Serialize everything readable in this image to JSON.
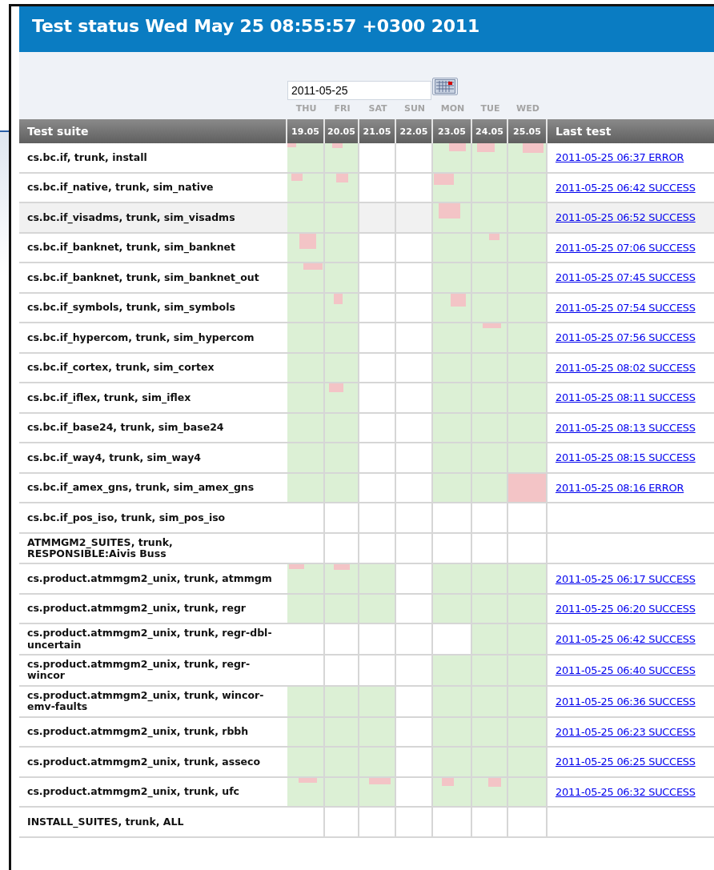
{
  "header": {
    "title": "Test status Wed May 25 08:55:57 +0300 2011"
  },
  "date_field": {
    "value": "2011-05-25"
  },
  "weekdays": [
    "THU",
    "FRI",
    "SAT",
    "SUN",
    "MON",
    "TUE",
    "WED"
  ],
  "table": {
    "columns": [
      "Test suite",
      "19.05",
      "20.05",
      "21.05",
      "22.05",
      "23.05",
      "24.05",
      "25.05",
      "Last test"
    ],
    "rows": [
      {
        "suite": "cs.bc.if, trunk, install",
        "highlighted": false,
        "days": [
          {
            "kind": "mixed"
          },
          {
            "kind": "mixed"
          },
          {
            "kind": "empty"
          },
          {
            "kind": "empty"
          },
          {
            "kind": "mixed"
          },
          {
            "kind": "mixed"
          },
          {
            "kind": "mixed"
          }
        ],
        "last_test": "2011-05-25 06:37 ERROR"
      },
      {
        "suite": "cs.bc.if_native, trunk, sim_native",
        "highlighted": false,
        "days": [
          {
            "kind": "mixed"
          },
          {
            "kind": "mixed"
          },
          {
            "kind": "empty"
          },
          {
            "kind": "empty"
          },
          {
            "kind": "mixed"
          },
          {
            "kind": "passed"
          },
          {
            "kind": "passed"
          }
        ],
        "last_test": "2011-05-25 06:42 SUCCESS"
      },
      {
        "suite": "cs.bc.if_visadms, trunk, sim_visadms",
        "highlighted": true,
        "days": [
          {
            "kind": "passed"
          },
          {
            "kind": "passed"
          },
          {
            "kind": "empty"
          },
          {
            "kind": "empty"
          },
          {
            "kind": "mixed"
          },
          {
            "kind": "passed"
          },
          {
            "kind": "passed"
          }
        ],
        "last_test": "2011-05-25 06:52 SUCCESS"
      },
      {
        "suite": "cs.bc.if_banknet, trunk, sim_banknet",
        "highlighted": false,
        "days": [
          {
            "kind": "mixed"
          },
          {
            "kind": "passed"
          },
          {
            "kind": "empty"
          },
          {
            "kind": "empty"
          },
          {
            "kind": "passed"
          },
          {
            "kind": "mixed"
          },
          {
            "kind": "passed"
          }
        ],
        "last_test": "2011-05-25 07:06 SUCCESS"
      },
      {
        "suite": "cs.bc.if_banknet, trunk, sim_banknet_out",
        "highlighted": false,
        "days": [
          {
            "kind": "mixed"
          },
          {
            "kind": "passed"
          },
          {
            "kind": "empty"
          },
          {
            "kind": "empty"
          },
          {
            "kind": "passed"
          },
          {
            "kind": "passed"
          },
          {
            "kind": "passed"
          }
        ],
        "last_test": "2011-05-25 07:45 SUCCESS"
      },
      {
        "suite": "cs.bc.if_symbols, trunk, sim_symbols",
        "highlighted": false,
        "days": [
          {
            "kind": "passed"
          },
          {
            "kind": "mixed"
          },
          {
            "kind": "empty"
          },
          {
            "kind": "empty"
          },
          {
            "kind": "mixed"
          },
          {
            "kind": "passed"
          },
          {
            "kind": "passed"
          }
        ],
        "last_test": "2011-05-25 07:54 SUCCESS"
      },
      {
        "suite": "cs.bc.if_hypercom, trunk, sim_hypercom",
        "highlighted": false,
        "days": [
          {
            "kind": "passed"
          },
          {
            "kind": "passed"
          },
          {
            "kind": "empty"
          },
          {
            "kind": "empty"
          },
          {
            "kind": "passed"
          },
          {
            "kind": "mixed"
          },
          {
            "kind": "passed"
          }
        ],
        "last_test": "2011-05-25 07:56 SUCCESS"
      },
      {
        "suite": "cs.bc.if_cortex, trunk, sim_cortex",
        "highlighted": false,
        "days": [
          {
            "kind": "passed"
          },
          {
            "kind": "passed"
          },
          {
            "kind": "empty"
          },
          {
            "kind": "empty"
          },
          {
            "kind": "passed"
          },
          {
            "kind": "passed"
          },
          {
            "kind": "passed"
          }
        ],
        "last_test": "2011-05-25 08:02 SUCCESS"
      },
      {
        "suite": "cs.bc.if_iflex, trunk, sim_iflex",
        "highlighted": false,
        "days": [
          {
            "kind": "passed"
          },
          {
            "kind": "mixed"
          },
          {
            "kind": "empty"
          },
          {
            "kind": "empty"
          },
          {
            "kind": "passed"
          },
          {
            "kind": "passed"
          },
          {
            "kind": "passed"
          }
        ],
        "last_test": "2011-05-25 08:11 SUCCESS"
      },
      {
        "suite": "cs.bc.if_base24, trunk, sim_base24",
        "highlighted": false,
        "days": [
          {
            "kind": "passed"
          },
          {
            "kind": "passed"
          },
          {
            "kind": "empty"
          },
          {
            "kind": "empty"
          },
          {
            "kind": "passed"
          },
          {
            "kind": "passed"
          },
          {
            "kind": "passed"
          }
        ],
        "last_test": "2011-05-25 08:13 SUCCESS"
      },
      {
        "suite": "cs.bc.if_way4, trunk, sim_way4",
        "highlighted": false,
        "days": [
          {
            "kind": "passed"
          },
          {
            "kind": "passed"
          },
          {
            "kind": "empty"
          },
          {
            "kind": "empty"
          },
          {
            "kind": "passed"
          },
          {
            "kind": "passed"
          },
          {
            "kind": "passed"
          }
        ],
        "last_test": "2011-05-25 08:15 SUCCESS"
      },
      {
        "suite": "cs.bc.if_amex_gns, trunk, sim_amex_gns",
        "highlighted": false,
        "days": [
          {
            "kind": "passed"
          },
          {
            "kind": "passed"
          },
          {
            "kind": "empty"
          },
          {
            "kind": "empty"
          },
          {
            "kind": "passed"
          },
          {
            "kind": "passed"
          },
          {
            "kind": "failed"
          }
        ],
        "last_test": "2011-05-25 08:16 ERROR"
      },
      {
        "suite": "cs.bc.if_pos_iso, trunk, sim_pos_iso",
        "highlighted": false,
        "days": [
          {
            "kind": "empty"
          },
          {
            "kind": "empty"
          },
          {
            "kind": "empty"
          },
          {
            "kind": "empty"
          },
          {
            "kind": "empty"
          },
          {
            "kind": "empty"
          },
          {
            "kind": "empty"
          }
        ]
      },
      {
        "suite": "ATMMGM2_SUITES, trunk, RESPONSIBLE:Aivis Buss",
        "highlighted": false,
        "days": [
          {
            "kind": "empty"
          },
          {
            "kind": "empty"
          },
          {
            "kind": "empty"
          },
          {
            "kind": "empty"
          },
          {
            "kind": "empty"
          },
          {
            "kind": "empty"
          },
          {
            "kind": "empty"
          }
        ]
      },
      {
        "suite": "cs.product.atmmgm2_unix, trunk, atmmgm",
        "highlighted": false,
        "days": [
          {
            "kind": "mixed"
          },
          {
            "kind": "mixed"
          },
          {
            "kind": "passed"
          },
          {
            "kind": "empty"
          },
          {
            "kind": "passed"
          },
          {
            "kind": "passed"
          },
          {
            "kind": "passed"
          }
        ],
        "last_test": "2011-05-25 06:17 SUCCESS"
      },
      {
        "suite": "cs.product.atmmgm2_unix, trunk, regr",
        "highlighted": false,
        "days": [
          {
            "kind": "passed"
          },
          {
            "kind": "passed"
          },
          {
            "kind": "passed"
          },
          {
            "kind": "empty"
          },
          {
            "kind": "passed"
          },
          {
            "kind": "passed"
          },
          {
            "kind": "passed"
          }
        ],
        "last_test": "2011-05-25 06:20 SUCCESS"
      },
      {
        "suite": "cs.product.atmmgm2_unix, trunk, regr-dbl-uncertain",
        "highlighted": false,
        "days": [
          {
            "kind": "empty"
          },
          {
            "kind": "empty"
          },
          {
            "kind": "empty"
          },
          {
            "kind": "empty"
          },
          {
            "kind": "empty"
          },
          {
            "kind": "passed"
          },
          {
            "kind": "passed"
          }
        ],
        "last_test": "2011-05-25 06:42 SUCCESS"
      },
      {
        "suite": "cs.product.atmmgm2_unix, trunk, regr-wincor",
        "highlighted": false,
        "days": [
          {
            "kind": "empty"
          },
          {
            "kind": "empty"
          },
          {
            "kind": "empty"
          },
          {
            "kind": "empty"
          },
          {
            "kind": "passed"
          },
          {
            "kind": "passed"
          },
          {
            "kind": "passed"
          }
        ],
        "last_test": "2011-05-25 06:40 SUCCESS"
      },
      {
        "suite": "cs.product.atmmgm2_unix, trunk, wincor-emv-faults",
        "highlighted": false,
        "days": [
          {
            "kind": "passed"
          },
          {
            "kind": "passed"
          },
          {
            "kind": "passed"
          },
          {
            "kind": "empty"
          },
          {
            "kind": "passed"
          },
          {
            "kind": "passed"
          },
          {
            "kind": "passed"
          }
        ],
        "last_test": "2011-05-25 06:36 SUCCESS"
      },
      {
        "suite": "cs.product.atmmgm2_unix, trunk, rbbh",
        "highlighted": false,
        "days": [
          {
            "kind": "passed"
          },
          {
            "kind": "passed"
          },
          {
            "kind": "passed"
          },
          {
            "kind": "empty"
          },
          {
            "kind": "passed"
          },
          {
            "kind": "passed"
          },
          {
            "kind": "passed"
          }
        ],
        "last_test": "2011-05-25 06:23 SUCCESS"
      },
      {
        "suite": "cs.product.atmmgm2_unix, trunk, asseco",
        "highlighted": false,
        "days": [
          {
            "kind": "passed"
          },
          {
            "kind": "passed"
          },
          {
            "kind": "passed"
          },
          {
            "kind": "empty"
          },
          {
            "kind": "passed"
          },
          {
            "kind": "passed"
          },
          {
            "kind": "passed"
          }
        ],
        "last_test": "2011-05-25 06:25 SUCCESS"
      },
      {
        "suite": "cs.product.atmmgm2_unix, trunk, ufc",
        "highlighted": false,
        "days": [
          {
            "kind": "mixed"
          },
          {
            "kind": "passed"
          },
          {
            "kind": "mixed"
          },
          {
            "kind": "empty"
          },
          {
            "kind": "mixed"
          },
          {
            "kind": "mixed"
          },
          {
            "kind": "passed"
          }
        ],
        "last_test": "2011-05-25 06:32 SUCCESS"
      },
      {
        "suite": "INSTALL_SUITES, trunk, ALL",
        "highlighted": false,
        "days": [
          {
            "kind": "empty"
          },
          {
            "kind": "empty"
          },
          {
            "kind": "empty"
          },
          {
            "kind": "empty"
          },
          {
            "kind": "empty"
          },
          {
            "kind": "empty"
          },
          {
            "kind": "empty"
          }
        ]
      }
    ]
  }
}
